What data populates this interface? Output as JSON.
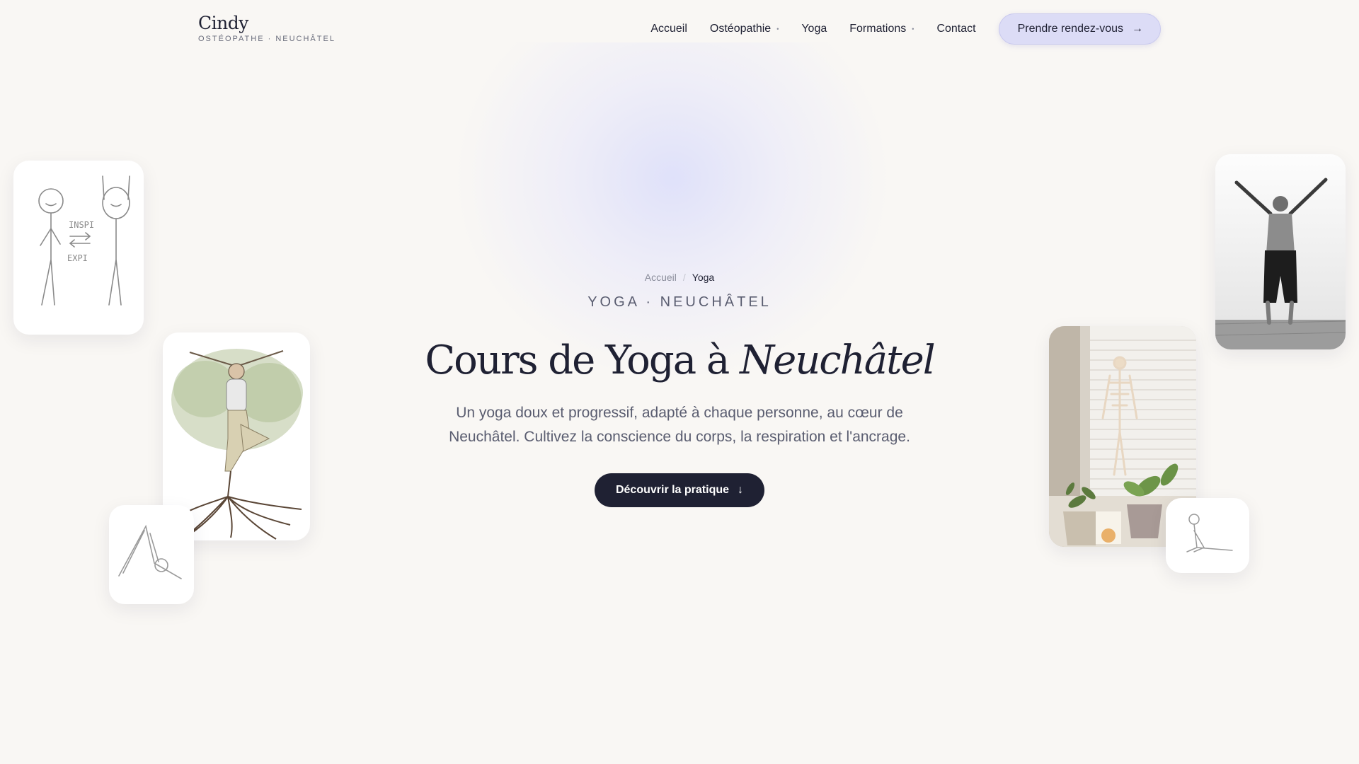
{
  "header": {
    "logo_name": "Cindy",
    "logo_subtitle": "OSTÉOPATHE · NEUCHÂTEL",
    "nav": [
      {
        "label": "Accueil",
        "dropdown": false
      },
      {
        "label": "Ostéopathie",
        "dropdown": true
      },
      {
        "label": "Yoga",
        "dropdown": false
      },
      {
        "label": "Formations",
        "dropdown": true
      },
      {
        "label": "Contact",
        "dropdown": false
      }
    ],
    "cta_label": "Prendre rendez-vous",
    "cta_icon": "arrow-right-icon"
  },
  "hero": {
    "breadcrumb": {
      "home": "Accueil",
      "separator": "/",
      "current": "Yoga"
    },
    "eyebrow": "YOGA · NEUCHÂTEL",
    "title_main": "Cours de Yoga à",
    "title_italic": "Neuchâtel",
    "lead": "Un yoga doux et progressif, adapté à chaque personne, au cœur de Neuchâtel. Cultivez la conscience du corps, la respiration et l'ancrage.",
    "button_label": "Découvrir la pratique",
    "button_icon": "arrow-down-icon"
  },
  "illustrations": {
    "breathing_sketch_text_1": "INSPI",
    "breathing_sketch_text_2": "EXPI"
  },
  "colors": {
    "background": "#f9f7f4",
    "ink": "#1f2133",
    "accent_lavender": "#dcdcf6",
    "muted": "#5a5d70"
  }
}
